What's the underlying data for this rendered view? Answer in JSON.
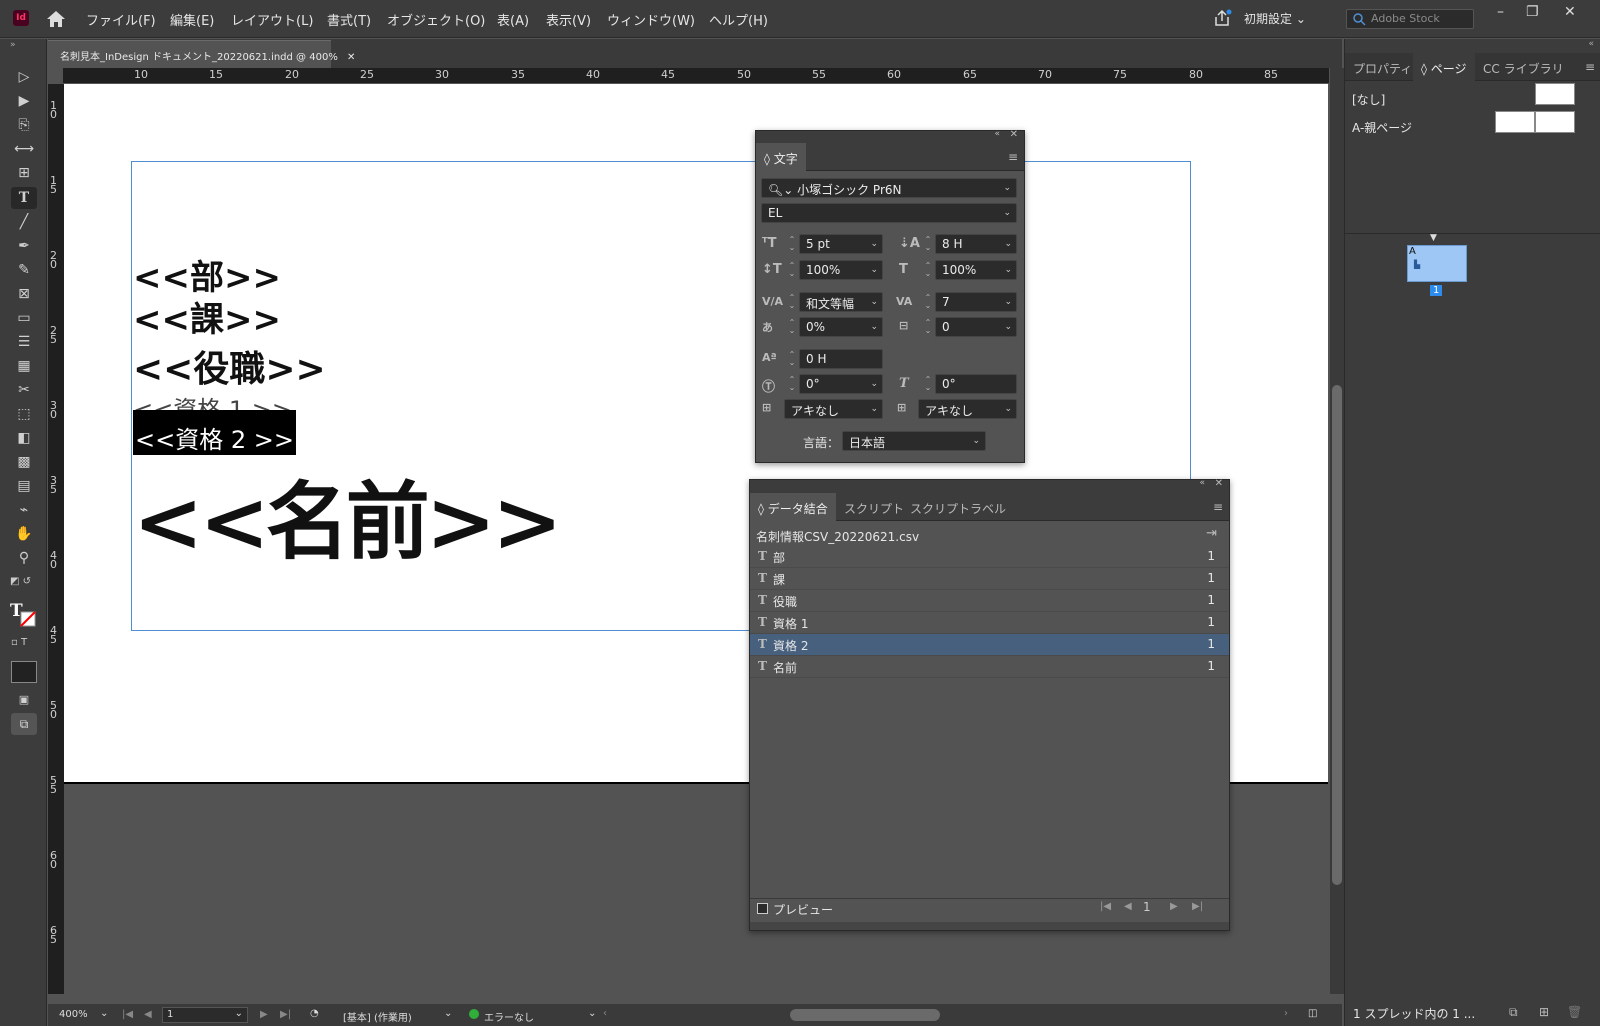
{
  "app": {
    "icon_label": "Id"
  },
  "menu": [
    "ファイル(F)",
    "編集(E)",
    "レイアウト(L)",
    "書式(T)",
    "オブジェクト(O)",
    "表(A)",
    "表示(V)",
    "ウィンドウ(W)",
    "ヘルプ(H)"
  ],
  "workspace": {
    "label": "初期設定"
  },
  "stock_search": {
    "placeholder": "Adobe Stock"
  },
  "doc_tab": {
    "title": "名刺見本_InDesign ドキュメント_20220621.indd @ 400%"
  },
  "ruler_top": [
    "10",
    "15",
    "20",
    "25",
    "30",
    "35",
    "40",
    "45",
    "50",
    "55",
    "60",
    "65",
    "70",
    "75",
    "80",
    "85"
  ],
  "ruler_left": [
    "10",
    "15",
    "20",
    "25",
    "30",
    "35",
    "40",
    "45",
    "50",
    "55",
    "60",
    "65"
  ],
  "canvas": {
    "ph_bu": "<<部>>",
    "ph_ka": "<<課>>",
    "ph_yakushoku": "<<役職>>",
    "ph_shikaku1": "<<資格 1 >>",
    "ph_shikaku2": "<<資格 2 >>",
    "ph_namae": "<<名前>>"
  },
  "char_panel": {
    "tab": "文字",
    "font_family": "小塚ゴシック Pr6N",
    "font_style": "EL",
    "size": "5 pt",
    "leading": "8 H",
    "vscale": "100%",
    "hscale": "100%",
    "kerning": "和文等幅",
    "tracking": "7",
    "tsume": "0%",
    "grid": "0",
    "baseline": "0 H",
    "rotate": "0°",
    "skew": "0°",
    "aki_before": "アキなし",
    "aki_after": "アキなし",
    "lang_label": "言語：",
    "lang": "日本語"
  },
  "data_merge": {
    "tabs": [
      "データ結合",
      "スクリプト",
      "スクリプトラベル"
    ],
    "source": "名刺情報CSV_20220621.csv",
    "fields": [
      {
        "name": "部",
        "count": "1"
      },
      {
        "name": "課",
        "count": "1"
      },
      {
        "name": "役職",
        "count": "1"
      },
      {
        "name": "資格 1",
        "count": "1"
      },
      {
        "name": "資格 2",
        "count": "1"
      },
      {
        "name": "名前",
        "count": "1"
      }
    ],
    "selected_index": 4,
    "preview_label": "プレビュー",
    "record": "1"
  },
  "right_panel": {
    "tabs": [
      "プロパティ",
      "ページ",
      "CC ライブラリ"
    ],
    "none_label": "[なし]",
    "parent_label": "A-親ページ",
    "page_number": "1",
    "footer": "1 スプレッド内の 1 ..."
  },
  "status": {
    "zoom": "400%",
    "page": "1",
    "style": "[基本] (作業用)",
    "errors": "エラーなし"
  },
  "colors": {
    "accent": "#46607d",
    "frame": "#4f8fd1",
    "ok": "#2fae3a",
    "page_thumb": "#9ec7f5"
  }
}
